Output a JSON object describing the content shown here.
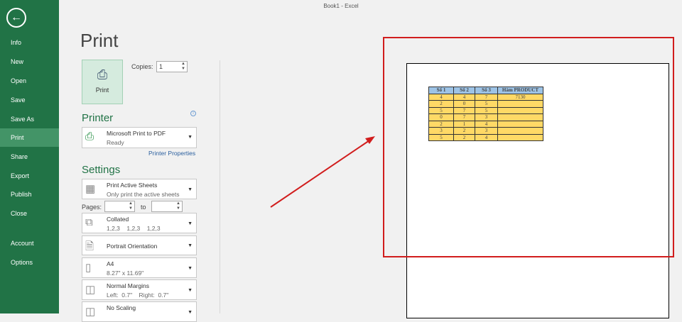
{
  "window_title": "Book1 - Excel",
  "sidebar": {
    "back_icon": "arrow-left-icon",
    "items": [
      {
        "label": "Info"
      },
      {
        "label": "New"
      },
      {
        "label": "Open"
      },
      {
        "label": "Save"
      },
      {
        "label": "Save As"
      },
      {
        "label": "Print",
        "active": true
      },
      {
        "label": "Share"
      },
      {
        "label": "Export"
      },
      {
        "label": "Publish"
      },
      {
        "label": "Close"
      },
      {
        "label": "Account"
      },
      {
        "label": "Options"
      }
    ]
  },
  "print": {
    "title": "Print",
    "button_label": "Print",
    "copies_label": "Copies:",
    "copies_value": "1"
  },
  "printer": {
    "heading": "Printer",
    "name": "Microsoft Print to PDF",
    "status": "Ready",
    "properties_link": "Printer Properties"
  },
  "settings": {
    "heading": "Settings",
    "sheets": {
      "title": "Print Active Sheets",
      "sub": "Only print the active sheets"
    },
    "pages_label": "Pages:",
    "to_label": "to",
    "pages_from": "",
    "pages_to": "",
    "collated": {
      "title": "Collated",
      "sub": "1,2,3    1,2,3    1,2,3"
    },
    "orientation": {
      "title": "Portrait Orientation"
    },
    "paper": {
      "title": "A4",
      "sub": "8.27\" x 11.69\""
    },
    "margins": {
      "title": "Normal Margins",
      "sub": "Left:  0.7\"    Right:  0.7\""
    },
    "scaling": {
      "title": "No Scaling"
    }
  },
  "preview": {
    "headers": [
      "Số 1",
      "Số 2",
      "Số 3",
      "Hàm PRODUCT"
    ],
    "rows": [
      [
        "4",
        "4",
        "7",
        "7130"
      ],
      [
        "2",
        "0",
        "5",
        ""
      ],
      [
        "5",
        "7",
        "5",
        ""
      ],
      [
        "0",
        "7",
        "3",
        ""
      ],
      [
        "2",
        "1",
        "4",
        ""
      ],
      [
        "3",
        "2",
        "3",
        ""
      ],
      [
        "5",
        "2",
        "4",
        ""
      ]
    ]
  },
  "colors": {
    "accent": "#217346",
    "highlight": "#d11d1d"
  }
}
